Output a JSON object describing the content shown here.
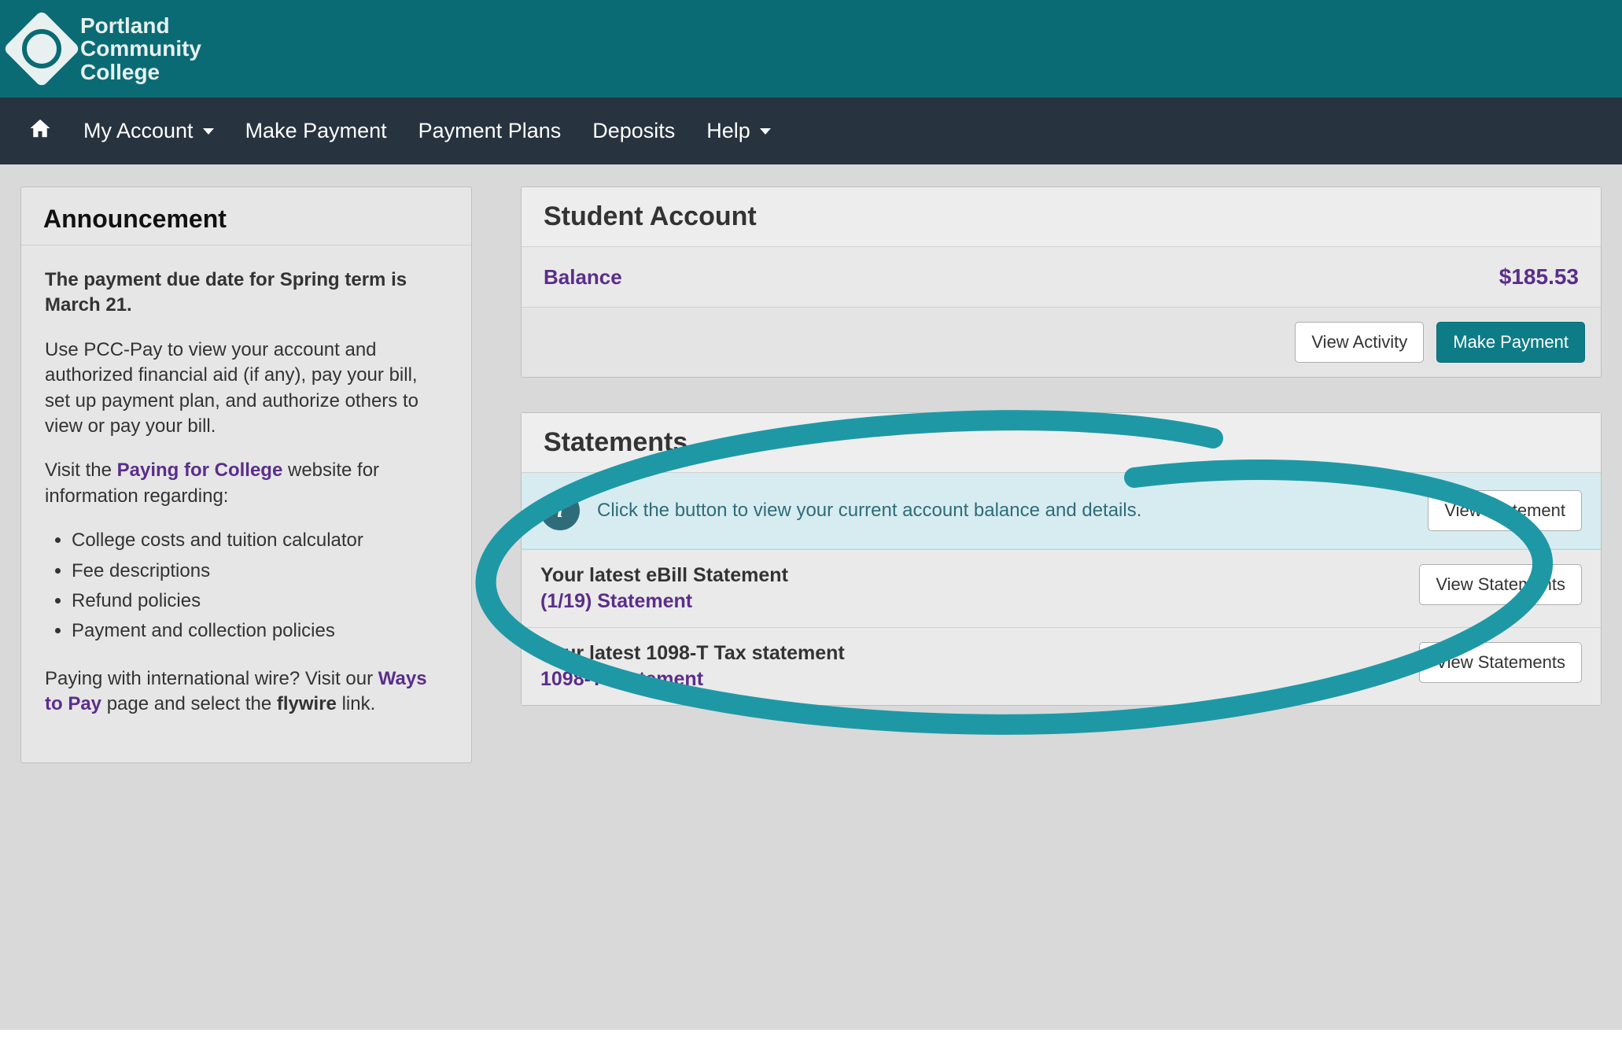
{
  "brand": {
    "line1": "Portland",
    "line2": "Community",
    "line3": "College"
  },
  "nav": {
    "my_account": "My Account",
    "make_payment": "Make Payment",
    "payment_plans": "Payment Plans",
    "deposits": "Deposits",
    "help": "Help"
  },
  "announcement": {
    "header": "Announcement",
    "p1a": "The payment due date for Spring term is March 21.",
    "p2": "Use PCC-Pay to view your account and authorized financial aid (if any), pay your bill, set up payment plan, and authorize others to view or pay your bill.",
    "p3_prefix": "Visit the ",
    "p3_link": "Paying for College",
    "p3_suffix": " website for information regarding:",
    "list": {
      "a": "College costs and tuition calculator",
      "b": "Fee descriptions",
      "c": "Refund policies",
      "d": "Payment and collection policies"
    },
    "p4_prefix": "Paying with international wire? Visit our ",
    "p4_link": "Ways to Pay",
    "p4_mid": " page and select the ",
    "p4_strong": "flywire",
    "p4_suffix": " link."
  },
  "student_account": {
    "header": "Student Account",
    "balance_label": "Balance",
    "balance_amount": "$185.53",
    "view_activity": "View Activity",
    "make_payment": "Make Payment"
  },
  "statements": {
    "header": "Statements",
    "info_msg": "Click the button to view your current account balance and details.",
    "view_statement": "View Statement",
    "ebill_title": "Your latest eBill Statement",
    "ebill_sub": "(1/19) Statement",
    "ebill_btn": "View Statements",
    "tax_title": "Your latest 1098-T Tax statement",
    "tax_sub": "1098-T Statement",
    "tax_btn": "View Statements"
  }
}
